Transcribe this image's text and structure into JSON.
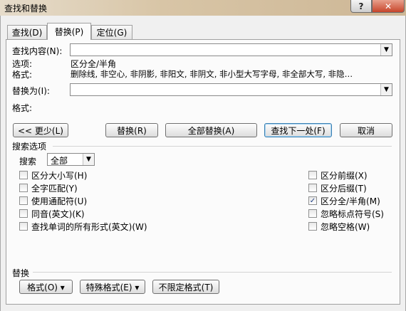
{
  "window": {
    "title": "查找和替换",
    "help": "?",
    "close": "✕"
  },
  "tabs": [
    {
      "label": "查找(D)"
    },
    {
      "label": "替换(P)"
    },
    {
      "label": "定位(G)"
    }
  ],
  "find": {
    "label": "查找内容(N):",
    "value": "",
    "options_label": "选项:",
    "options_value": "区分全/半角",
    "format_label": "格式:",
    "format_value": "删除线, 非空心, 非阴影, 非阳文, 非阴文, 非小型大写字母, 非全部大写, 非隐…"
  },
  "replace": {
    "label": "替换为(I):",
    "value": "",
    "format_label": "格式:"
  },
  "buttons": {
    "less": "<< 更少(L)",
    "replace": "替换(R)",
    "replace_all": "全部替换(A)",
    "find_next": "查找下一处(F)",
    "cancel": "取消"
  },
  "search_options": {
    "section_label": "搜索选项",
    "search_label": "搜索",
    "search_value": "全部",
    "left": [
      {
        "label": "区分大小写(H)",
        "checked": false
      },
      {
        "label": "全字匹配(Y)",
        "checked": false
      },
      {
        "label": "使用通配符(U)",
        "checked": false
      },
      {
        "label": "同音(英文)(K)",
        "checked": false
      },
      {
        "label": "查找单词的所有形式(英文)(W)",
        "checked": false
      }
    ],
    "right": [
      {
        "label": "区分前缀(X)",
        "checked": false
      },
      {
        "label": "区分后缀(T)",
        "checked": false
      },
      {
        "label": "区分全/半角(M)",
        "checked": true
      },
      {
        "label": "忽略标点符号(S)",
        "checked": false
      },
      {
        "label": "忽略空格(W)",
        "checked": false
      }
    ]
  },
  "bottom": {
    "section_label": "替换",
    "format_btn": "格式(O) ▾",
    "special_btn": "特殊格式(E) ▾",
    "no_format_btn": "不限定格式(T)"
  }
}
